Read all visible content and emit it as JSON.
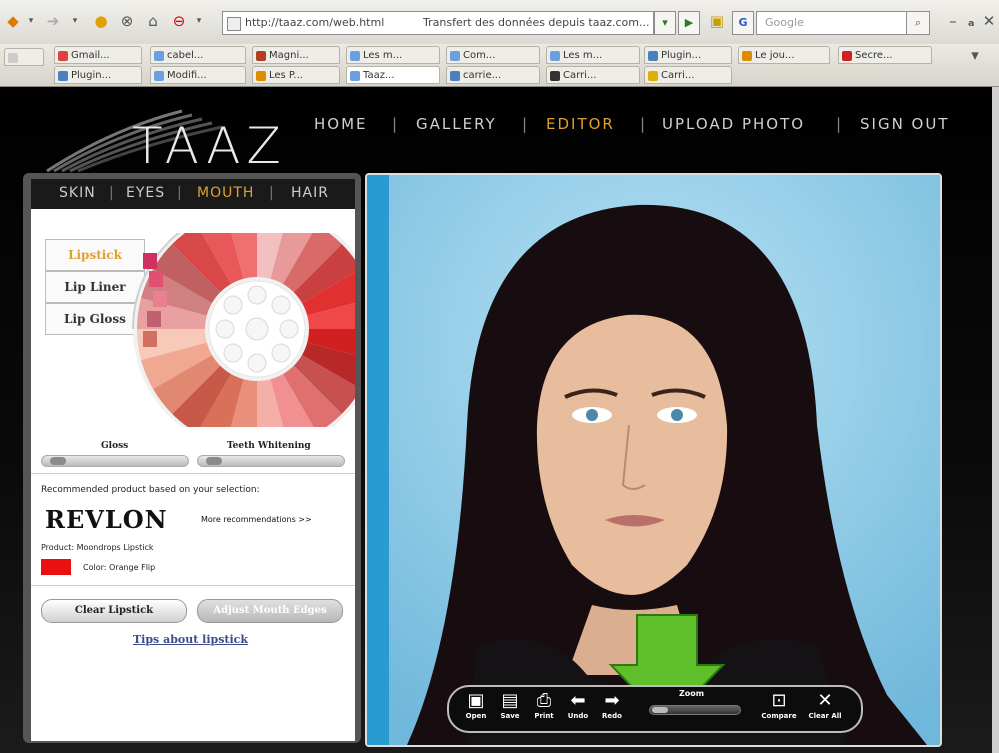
{
  "browser": {
    "url": "http://taaz.com/web.html",
    "page_status": "Transfert des données depuis taaz.com...",
    "search_placeholder": "Google",
    "tabs_row1": [
      "Gmail...",
      "cabel...",
      "Magni...",
      "Les m...",
      "Com...",
      "Les m...",
      "Plugin...",
      "Le jou...",
      "Secre..."
    ],
    "tabs_row2": [
      "Plugin...",
      "Modifi...",
      "Les P...",
      "Taaz...",
      "carrie...",
      "Carri...",
      "Carri..."
    ]
  },
  "site": {
    "logo": "TAAZ",
    "nav": [
      "HOME",
      "GALLERY",
      "EDITOR",
      "UPLOAD PHOTO",
      "SIGN OUT"
    ],
    "nav_separator": "|",
    "active_nav": "EDITOR",
    "accent_color": "#e0a030"
  },
  "left_panel": {
    "tabs": [
      "SKIN",
      "EYES",
      "MOUTH",
      "HAIR"
    ],
    "active_tab": "MOUTH",
    "side_tabs": [
      "Lipstick",
      "Lip Liner",
      "Lip Gloss"
    ],
    "active_side_tab": "Lipstick",
    "sliders": [
      "Gloss",
      "Teeth Whitening"
    ],
    "gloss_level": 0.05,
    "teeth_level": 0.05,
    "recommend_text": "Recommended product based on your selection:",
    "brand": "REVLON",
    "more_link": "More recommendations >>",
    "product": "Product: Moondrops Lipstick",
    "color_label": "Color: Orange Flip",
    "swatch_color": "#e81010",
    "clear_button": "Clear Lipstick",
    "adjust_button": "Adjust Mouth Edges",
    "tips_link": "Tips about lipstick"
  },
  "editor": {
    "zoom_label": "Zoom",
    "tools": [
      "Open",
      "Save",
      "Print",
      "Undo",
      "Redo",
      "Compare",
      "Clear All"
    ]
  }
}
